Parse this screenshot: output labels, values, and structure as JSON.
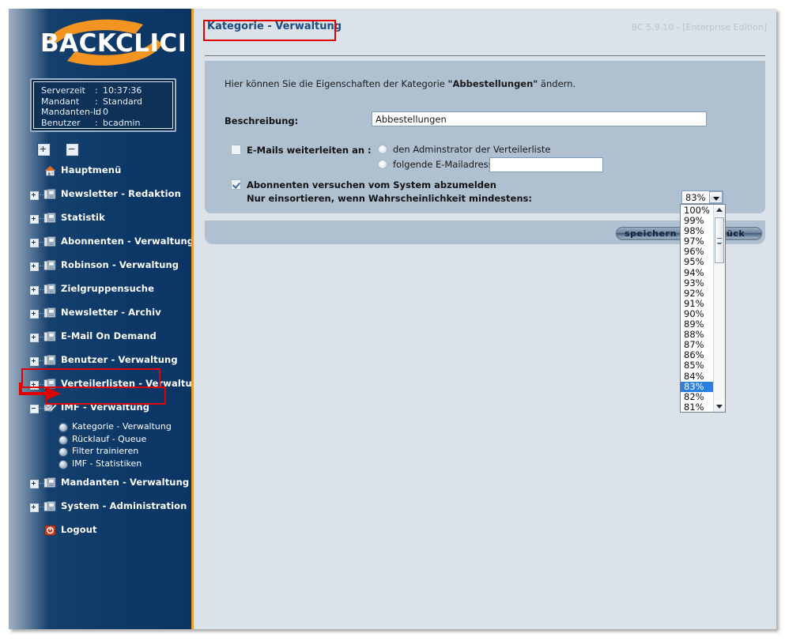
{
  "app": {
    "logo_text": "BACKCLICK",
    "version_text": "BC 5.9.10 - [Enterprise Edition]"
  },
  "server_info": {
    "rows": [
      {
        "key": "Serverzeit",
        "sep": ":",
        "value": "10:37:36"
      },
      {
        "key": "Mandant",
        "sep": ":",
        "value": "Standard"
      },
      {
        "key": "Mandanten-Id",
        "sep": ":",
        "value": "0"
      },
      {
        "key": "Benutzer",
        "sep": ":",
        "value": "bcadmin"
      }
    ]
  },
  "tree_controls": {
    "expand_all": "+",
    "collapse_all": "-"
  },
  "sidebar": {
    "items": [
      {
        "label": "Hauptmenü",
        "icon": "home-icon",
        "expandable": false,
        "expanded": false
      },
      {
        "label": "Newsletter - Redaktion",
        "icon": "folder-icon",
        "expandable": true,
        "expanded": false
      },
      {
        "label": "Statistik",
        "icon": "folder-icon",
        "expandable": true,
        "expanded": false
      },
      {
        "label": "Abonnenten - Verwaltung",
        "icon": "folder-icon",
        "expandable": true,
        "expanded": false
      },
      {
        "label": "Robinson - Verwaltung",
        "icon": "folder-icon",
        "expandable": true,
        "expanded": false
      },
      {
        "label": "Zielgruppensuche",
        "icon": "folder-icon",
        "expandable": true,
        "expanded": false
      },
      {
        "label": "Newsletter - Archiv",
        "icon": "folder-icon",
        "expandable": true,
        "expanded": false
      },
      {
        "label": "E-Mail On Demand",
        "icon": "folder-icon",
        "expandable": true,
        "expanded": false
      },
      {
        "label": "Benutzer - Verwaltung",
        "icon": "folder-icon",
        "expandable": true,
        "expanded": false
      },
      {
        "label": "Verteilerlisten - Verwaltung",
        "icon": "folder-icon",
        "expandable": true,
        "expanded": false
      },
      {
        "label": "IMF - Verwaltung",
        "icon": "imf-icon",
        "expandable": true,
        "expanded": true
      },
      {
        "label": "Mandanten - Verwaltung",
        "icon": "folder-icon",
        "expandable": true,
        "expanded": false
      },
      {
        "label": "System - Administration",
        "icon": "folder-icon",
        "expandable": true,
        "expanded": false
      },
      {
        "label": "Logout",
        "icon": "power-icon",
        "expandable": false,
        "expanded": false
      }
    ],
    "imf_subitems": [
      {
        "label": "Kategorie - Verwaltung",
        "selected": true
      },
      {
        "label": "Rücklauf - Queue",
        "selected": false
      },
      {
        "label": "Filter trainieren",
        "selected": false
      },
      {
        "label": "IMF - Statistiken",
        "selected": false
      }
    ]
  },
  "page": {
    "title": "Kategorie - Verwaltung",
    "intro_prefix": "Hier können Sie die Eigenschaften der Kategorie ",
    "intro_bold": "\"Abbestellungen\"",
    "intro_suffix": " ändern."
  },
  "form": {
    "description_label": "Beschreibung:",
    "description_value": "Abbestellungen",
    "description_placeholder": "",
    "forward_checkbox_label": "E-Mails weiterleiten an :",
    "forward_checked": false,
    "radio_admin_label": "den Adminstrator der Verteilerliste",
    "radio_admin_selected": false,
    "radio_email_label": "folgende E-Mailadresse :",
    "radio_email_selected": false,
    "email_value": "",
    "email_placeholder": "",
    "unsubscribe_checkbox_label": "Abonnenten versuchen vom System abzumelden",
    "unsubscribe_checked": true,
    "threshold_label": "Nur einsortieren, wenn Wahrscheinlichkeit mindestens:",
    "threshold_value": "83%",
    "threshold_options": [
      "100%",
      "99%",
      "98%",
      "97%",
      "96%",
      "95%",
      "94%",
      "93%",
      "92%",
      "91%",
      "90%",
      "89%",
      "88%",
      "87%",
      "86%",
      "85%",
      "84%",
      "83%",
      "82%",
      "81%"
    ],
    "threshold_open": true
  },
  "actions": {
    "save_label": "speichern",
    "back_label": "zurück"
  },
  "colors": {
    "accent_orange": "#e8a13a",
    "sidebar_dark": "#0c3968",
    "title_blue": "#1e4b80",
    "panel_blue": "#afc0d1",
    "page_bg": "#dbe2ea",
    "annotation_red": "#e00000",
    "select_highlight": "#2a7fe0"
  }
}
